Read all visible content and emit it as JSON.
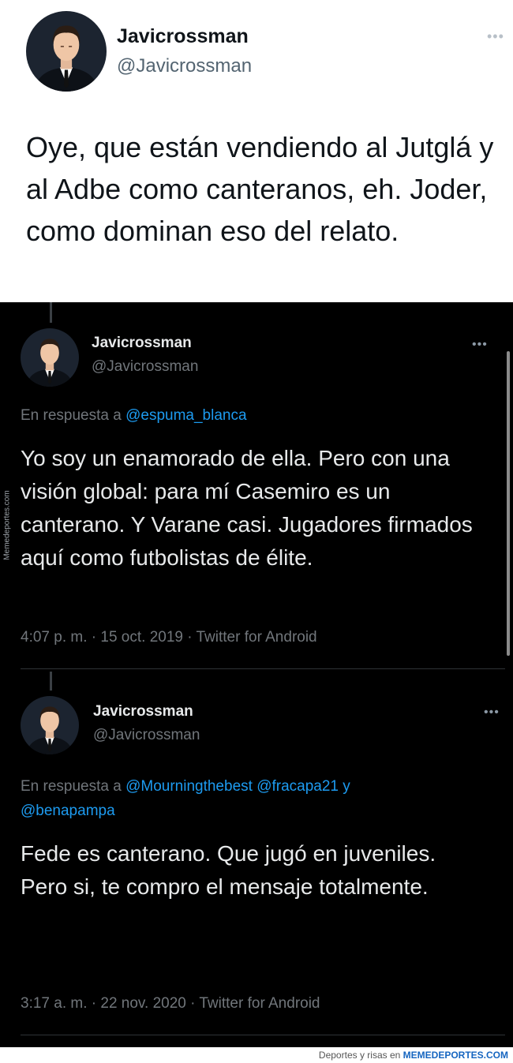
{
  "top_tweet": {
    "name": "Javicrossman",
    "handle": "@Javicrossman",
    "more": "•••",
    "text": "Oye, que están vendiendo al Jutglá y al Adbe como canteranos, eh. Joder, como dominan eso del relato."
  },
  "reply1": {
    "name": "Javicrossman",
    "handle": "@Javicrossman",
    "more": "•••",
    "reply_prefix": "En respuesta a",
    "mention": "@espuma_blanca",
    "text": "Yo soy un enamorado de ella. Pero con una visión global: para mí Casemiro es un canterano. Y Varane casi. Jugadores firmados aquí como futbolistas de élite.",
    "meta": "4:07 p. m. · 15 oct. 2019 · Twitter for Android"
  },
  "reply2": {
    "name": "Javicrossman",
    "handle": "@Javicrossman",
    "more": "•••",
    "reply_prefix": "En respuesta a",
    "mention_1": "@Mourningthebest",
    "mention_2": "@fracapa21",
    "joiner": "y",
    "mention_3": "@benapampa",
    "text_line_1": "Fede es canterano. Que jugó en juveniles.",
    "text_line_2": "Pero si, te compro el mensaje totalmente.",
    "meta": "3:17 a. m. · 22 nov. 2020 · Twitter for Android"
  },
  "watermark": {
    "side": "Memedeportes.com",
    "footer_prefix": "Deportes y risas en",
    "footer_brand": "MEMEDEPORTES.COM"
  },
  "colors": {
    "mention_blue": "#1d9bf0",
    "dark_bg": "#000000",
    "light_bg": "#ffffff"
  },
  "icons": {
    "avatar": "man-in-suit-avatar",
    "more": "more-options-icon"
  }
}
